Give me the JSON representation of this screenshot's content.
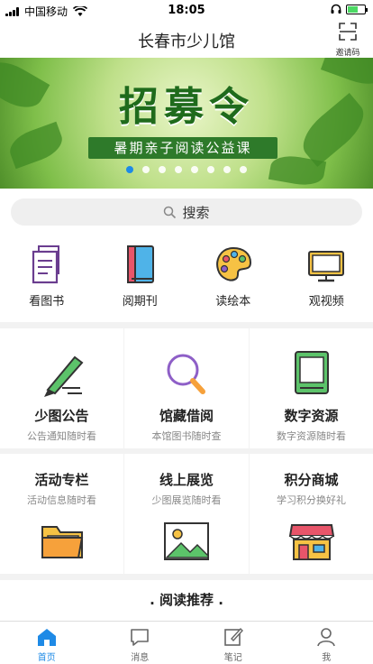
{
  "status": {
    "carrier": "中国移动",
    "time": "18:05"
  },
  "nav": {
    "title": "长春市少儿馆",
    "invite_label": "邀请码"
  },
  "banner": {
    "title": "招募令",
    "subtitle": "暑期亲子阅读公益课",
    "dot_count": 8,
    "active_dot": 0
  },
  "search": {
    "label": "搜索"
  },
  "quick_links": [
    {
      "label": "看图书",
      "icon": "book-document-icon"
    },
    {
      "label": "阅期刊",
      "icon": "magazine-icon"
    },
    {
      "label": "读绘本",
      "icon": "palette-icon"
    },
    {
      "label": "观视频",
      "icon": "monitor-icon"
    }
  ],
  "features": [
    {
      "title": "少图公告",
      "subtitle": "公告通知随时看",
      "icon": "pen-icon"
    },
    {
      "title": "馆藏借阅",
      "subtitle": "本馆图书随时查",
      "icon": "magnifier-icon"
    },
    {
      "title": "数字资源",
      "subtitle": "数字资源随时看",
      "icon": "ebook-icon"
    },
    {
      "title": "活动专栏",
      "subtitle": "活动信息随时看",
      "icon": "folder-icon"
    },
    {
      "title": "线上展览",
      "subtitle": "少图展览随时看",
      "icon": "picture-icon"
    },
    {
      "title": "积分商城",
      "subtitle": "学习积分换好礼",
      "icon": "store-icon"
    }
  ],
  "recommend": {
    "title": ". 阅读推荐 ."
  },
  "tabs": [
    {
      "label": "首页",
      "icon": "home-icon",
      "active": true
    },
    {
      "label": "消息",
      "icon": "message-icon",
      "active": false
    },
    {
      "label": "笔记",
      "icon": "note-icon",
      "active": false
    },
    {
      "label": "我",
      "icon": "user-icon",
      "active": false
    }
  ],
  "colors": {
    "accent": "#1e8ae6",
    "battery": "#4cd964",
    "banner_green": "#2e7a2a"
  }
}
